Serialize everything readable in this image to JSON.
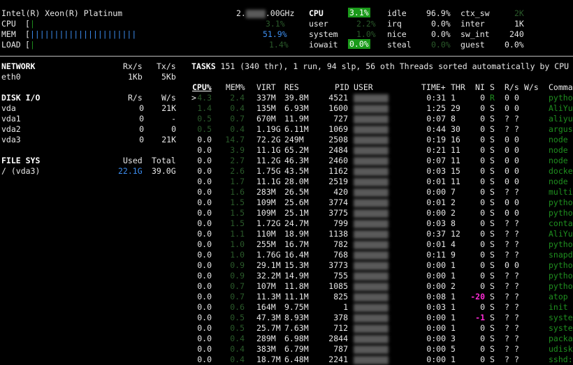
{
  "header": {
    "cpu_model": "Intel(R) Xeon(R) Platinum",
    "freq_prefix": "2.",
    "freq_suffix": ".00GHz",
    "cpu_label": "CPU",
    "cpu_value": "3.1%",
    "mem_label": "MEM",
    "mem_value": "51.9%",
    "load_label": "LOAD",
    "load_value": "1.4%",
    "left_bracket": "[",
    "mem_bar": "||||||||||||||||||||||",
    "stats": {
      "cpu_title": "CPU",
      "cpu_total": "3.1%",
      "user_label": "user",
      "user_value": "2.2%",
      "system_label": "system",
      "system_value": "1.0%",
      "iowait_label": "iowait",
      "iowait_value": "0.0%",
      "idle_label": "idle",
      "idle_value": "96.9%",
      "irq_label": "irq",
      "irq_value": "0.0%",
      "nice_label": "nice",
      "nice_value": "0.0%",
      "steal_label": "steal",
      "steal_value": "0.0%",
      "ctxsw_label": "ctx_sw",
      "ctxsw_value": "2K",
      "inter_label": "inter",
      "inter_value": "1K",
      "swint_label": "sw_int",
      "swint_value": "240",
      "guest_label": "guest",
      "guest_value": "0.0%"
    }
  },
  "network": {
    "title": "NETWORK",
    "rx_label": "Rx/s",
    "tx_label": "Tx/s",
    "iface": "eth0",
    "rx": "1Kb",
    "tx": "5Kb"
  },
  "disk": {
    "title": "DISK I/O",
    "r_label": "R/s",
    "w_label": "W/s",
    "rows": [
      {
        "name": "vda",
        "r": "0",
        "w": "21K"
      },
      {
        "name": "vda1",
        "r": "0",
        "w": "-"
      },
      {
        "name": "vda2",
        "r": "0",
        "w": "0"
      },
      {
        "name": "vda3",
        "r": "0",
        "w": "21K"
      }
    ]
  },
  "fs": {
    "title": "FILE SYS",
    "used_label": "Used",
    "total_label": "Total",
    "name": "/ (vda3)",
    "used": "22.1G",
    "total": "39.0G"
  },
  "tasks": {
    "summary": "TASKS 151 (340 thr), 1 run, 94 slp, 56 oth Threads sorted automatically by CPU",
    "columns": {
      "cpu": "CPU%",
      "mem": "MEM%",
      "virt": "VIRT",
      "res": "RES",
      "pid": "PID",
      "user": "USER",
      "time": "TIME+",
      "thr": "THR",
      "ni": "NI",
      "s": "S",
      "rs": "R/s",
      "ws": "W/s",
      "cmd": "Comma"
    },
    "rows": [
      {
        "mark": ">",
        "cpu": "4.3",
        "mem": "2.4",
        "virt": "337M",
        "res": "39.8M",
        "pid": "4521",
        "time": "0:31",
        "thr": "1",
        "ni": "0",
        "s": "R",
        "rs": "0",
        "ws": "0",
        "cmd": "pytho",
        "cpu_c": "dg",
        "mem_c": "dg",
        "s_c": "g",
        "ni_c": ""
      },
      {
        "mark": "",
        "cpu": "1.4",
        "mem": "0.4",
        "virt": "135M",
        "res": "6.93M",
        "pid": "1600",
        "time": "1:25",
        "thr": "29",
        "ni": "0",
        "s": "S",
        "rs": "0",
        "ws": "0",
        "cmd": "AliYu",
        "cpu_c": "dg",
        "mem_c": "dg",
        "s_c": "",
        "ni_c": ""
      },
      {
        "mark": "",
        "cpu": "0.5",
        "mem": "0.7",
        "virt": "670M",
        "res": "11.9M",
        "pid": "727",
        "time": "0:07",
        "thr": "8",
        "ni": "0",
        "s": "S",
        "rs": "?",
        "ws": "?",
        "cmd": "aliyu",
        "cpu_c": "dg",
        "mem_c": "dg",
        "s_c": "",
        "ni_c": ""
      },
      {
        "mark": "",
        "cpu": "0.5",
        "mem": "0.4",
        "virt": "1.19G",
        "res": "6.11M",
        "pid": "1069",
        "time": "0:44",
        "thr": "30",
        "ni": "0",
        "s": "S",
        "rs": "?",
        "ws": "?",
        "cmd": "argus",
        "cpu_c": "dg",
        "mem_c": "dg",
        "s_c": "",
        "ni_c": ""
      },
      {
        "mark": "",
        "cpu": "0.0",
        "mem": "14.7",
        "virt": "72.2G",
        "res": "249M",
        "pid": "2508",
        "time": "0:19",
        "thr": "16",
        "ni": "0",
        "s": "S",
        "rs": "0",
        "ws": "0",
        "cmd": "node",
        "cpu_c": "",
        "mem_c": "dg",
        "s_c": "",
        "ni_c": ""
      },
      {
        "mark": "",
        "cpu": "0.0",
        "mem": "3.9",
        "virt": "11.1G",
        "res": "65.2M",
        "pid": "2484",
        "time": "0:21",
        "thr": "11",
        "ni": "0",
        "s": "S",
        "rs": "0",
        "ws": "0",
        "cmd": "node",
        "cpu_c": "",
        "mem_c": "dg",
        "s_c": "",
        "ni_c": ""
      },
      {
        "mark": "",
        "cpu": "0.0",
        "mem": "2.7",
        "virt": "11.2G",
        "res": "46.3M",
        "pid": "2460",
        "time": "0:07",
        "thr": "11",
        "ni": "0",
        "s": "S",
        "rs": "0",
        "ws": "0",
        "cmd": "node",
        "cpu_c": "",
        "mem_c": "dg",
        "s_c": "",
        "ni_c": ""
      },
      {
        "mark": "",
        "cpu": "0.0",
        "mem": "2.6",
        "virt": "1.75G",
        "res": "43.5M",
        "pid": "1162",
        "time": "0:03",
        "thr": "15",
        "ni": "0",
        "s": "S",
        "rs": "0",
        "ws": "0",
        "cmd": "docke",
        "cpu_c": "",
        "mem_c": "dg",
        "s_c": "",
        "ni_c": ""
      },
      {
        "mark": "",
        "cpu": "0.0",
        "mem": "1.7",
        "virt": "11.1G",
        "res": "28.0M",
        "pid": "2519",
        "time": "0:01",
        "thr": "11",
        "ni": "0",
        "s": "S",
        "rs": "0",
        "ws": "0",
        "cmd": "node",
        "cpu_c": "",
        "mem_c": "dg",
        "s_c": "",
        "ni_c": ""
      },
      {
        "mark": "",
        "cpu": "0.0",
        "mem": "1.6",
        "virt": "283M",
        "res": "26.5M",
        "pid": "420",
        "time": "0:00",
        "thr": "7",
        "ni": "0",
        "s": "S",
        "rs": "?",
        "ws": "?",
        "cmd": "multi",
        "cpu_c": "",
        "mem_c": "dg",
        "s_c": "",
        "ni_c": ""
      },
      {
        "mark": "",
        "cpu": "0.0",
        "mem": "1.5",
        "virt": "109M",
        "res": "25.6M",
        "pid": "3774",
        "time": "0:01",
        "thr": "2",
        "ni": "0",
        "s": "S",
        "rs": "0",
        "ws": "0",
        "cmd": "pytho",
        "cpu_c": "",
        "mem_c": "dg",
        "s_c": "",
        "ni_c": ""
      },
      {
        "mark": "",
        "cpu": "0.0",
        "mem": "1.5",
        "virt": "109M",
        "res": "25.1M",
        "pid": "3775",
        "time": "0:00",
        "thr": "2",
        "ni": "0",
        "s": "S",
        "rs": "0",
        "ws": "0",
        "cmd": "pytho",
        "cpu_c": "",
        "mem_c": "dg",
        "s_c": "",
        "ni_c": ""
      },
      {
        "mark": "",
        "cpu": "0.0",
        "mem": "1.5",
        "virt": "1.72G",
        "res": "24.7M",
        "pid": "799",
        "time": "0:03",
        "thr": "8",
        "ni": "0",
        "s": "S",
        "rs": "?",
        "ws": "?",
        "cmd": "conta",
        "cpu_c": "",
        "mem_c": "dg",
        "s_c": "",
        "ni_c": ""
      },
      {
        "mark": "",
        "cpu": "0.0",
        "mem": "1.1",
        "virt": "110M",
        "res": "18.9M",
        "pid": "1138",
        "time": "0:37",
        "thr": "12",
        "ni": "0",
        "s": "S",
        "rs": "?",
        "ws": "?",
        "cmd": "AliYu",
        "cpu_c": "",
        "mem_c": "dg",
        "s_c": "",
        "ni_c": ""
      },
      {
        "mark": "",
        "cpu": "0.0",
        "mem": "1.0",
        "virt": "255M",
        "res": "16.7M",
        "pid": "782",
        "time": "0:01",
        "thr": "4",
        "ni": "0",
        "s": "S",
        "rs": "?",
        "ws": "?",
        "cmd": "pytho",
        "cpu_c": "",
        "mem_c": "dg",
        "s_c": "",
        "ni_c": ""
      },
      {
        "mark": "",
        "cpu": "0.0",
        "mem": "1.0",
        "virt": "1.76G",
        "res": "16.4M",
        "pid": "768",
        "time": "0:11",
        "thr": "9",
        "ni": "0",
        "s": "S",
        "rs": "?",
        "ws": "?",
        "cmd": "snapd",
        "cpu_c": "",
        "mem_c": "dg",
        "s_c": "",
        "ni_c": ""
      },
      {
        "mark": "",
        "cpu": "0.0",
        "mem": "0.9",
        "virt": "29.1M",
        "res": "15.3M",
        "pid": "3773",
        "time": "0:00",
        "thr": "1",
        "ni": "0",
        "s": "S",
        "rs": "0",
        "ws": "0",
        "cmd": "pytho",
        "cpu_c": "",
        "mem_c": "dg",
        "s_c": "",
        "ni_c": ""
      },
      {
        "mark": "",
        "cpu": "0.0",
        "mem": "0.9",
        "virt": "32.2M",
        "res": "14.9M",
        "pid": "755",
        "time": "0:00",
        "thr": "1",
        "ni": "0",
        "s": "S",
        "rs": "?",
        "ws": "?",
        "cmd": "pytho",
        "cpu_c": "",
        "mem_c": "dg",
        "s_c": "",
        "ni_c": ""
      },
      {
        "mark": "",
        "cpu": "0.0",
        "mem": "0.7",
        "virt": "107M",
        "res": "11.8M",
        "pid": "1085",
        "time": "0:00",
        "thr": "2",
        "ni": "0",
        "s": "S",
        "rs": "?",
        "ws": "?",
        "cmd": "pytho",
        "cpu_c": "",
        "mem_c": "dg",
        "s_c": "",
        "ni_c": ""
      },
      {
        "mark": "",
        "cpu": "0.0",
        "mem": "0.7",
        "virt": "11.3M",
        "res": "11.1M",
        "pid": "825",
        "time": "0:08",
        "thr": "1",
        "ni": "-20",
        "s": "S",
        "rs": "?",
        "ws": "?",
        "cmd": "atop",
        "cpu_c": "",
        "mem_c": "dg",
        "s_c": "",
        "ni_c": "mag"
      },
      {
        "mark": "",
        "cpu": "0.0",
        "mem": "0.6",
        "virt": "164M",
        "res": "9.75M",
        "pid": "1",
        "time": "0:03",
        "thr": "1",
        "ni": "0",
        "s": "S",
        "rs": "?",
        "ws": "?",
        "cmd": "init",
        "cpu_c": "",
        "mem_c": "dg",
        "s_c": "",
        "ni_c": ""
      },
      {
        "mark": "",
        "cpu": "0.0",
        "mem": "0.5",
        "virt": "47.3M",
        "res": "8.93M",
        "pid": "378",
        "time": "0:00",
        "thr": "1",
        "ni": "-1",
        "s": "S",
        "rs": "?",
        "ws": "?",
        "cmd": "syste",
        "cpu_c": "",
        "mem_c": "dg",
        "s_c": "",
        "ni_c": "mag"
      },
      {
        "mark": "",
        "cpu": "0.0",
        "mem": "0.5",
        "virt": "25.7M",
        "res": "7.63M",
        "pid": "712",
        "time": "0:00",
        "thr": "1",
        "ni": "0",
        "s": "S",
        "rs": "?",
        "ws": "?",
        "cmd": "syste",
        "cpu_c": "",
        "mem_c": "dg",
        "s_c": "",
        "ni_c": ""
      },
      {
        "mark": "",
        "cpu": "0.0",
        "mem": "0.4",
        "virt": "289M",
        "res": "6.98M",
        "pid": "2844",
        "time": "0:00",
        "thr": "3",
        "ni": "0",
        "s": "S",
        "rs": "?",
        "ws": "?",
        "cmd": "packa",
        "cpu_c": "",
        "mem_c": "dg",
        "s_c": "",
        "ni_c": ""
      },
      {
        "mark": "",
        "cpu": "0.0",
        "mem": "0.4",
        "virt": "383M",
        "res": "6.79M",
        "pid": "787",
        "time": "0:00",
        "thr": "5",
        "ni": "0",
        "s": "S",
        "rs": "?",
        "ws": "?",
        "cmd": "udisk",
        "cpu_c": "",
        "mem_c": "dg",
        "s_c": "",
        "ni_c": ""
      },
      {
        "mark": "",
        "cpu": "0.0",
        "mem": "0.4",
        "virt": "18.7M",
        "res": "6.48M",
        "pid": "2241",
        "time": "0:00",
        "thr": "1",
        "ni": "0",
        "s": "S",
        "rs": "?",
        "ws": "?",
        "cmd": "sshd:",
        "cpu_c": "",
        "mem_c": "dg",
        "s_c": "",
        "ni_c": ""
      }
    ]
  },
  "colors": {
    "background": "#000000",
    "green": "#1f8f1f",
    "highlight": "#1a9a1a",
    "blue": "#3d8ef0",
    "magenta": "#ff2bd6"
  }
}
